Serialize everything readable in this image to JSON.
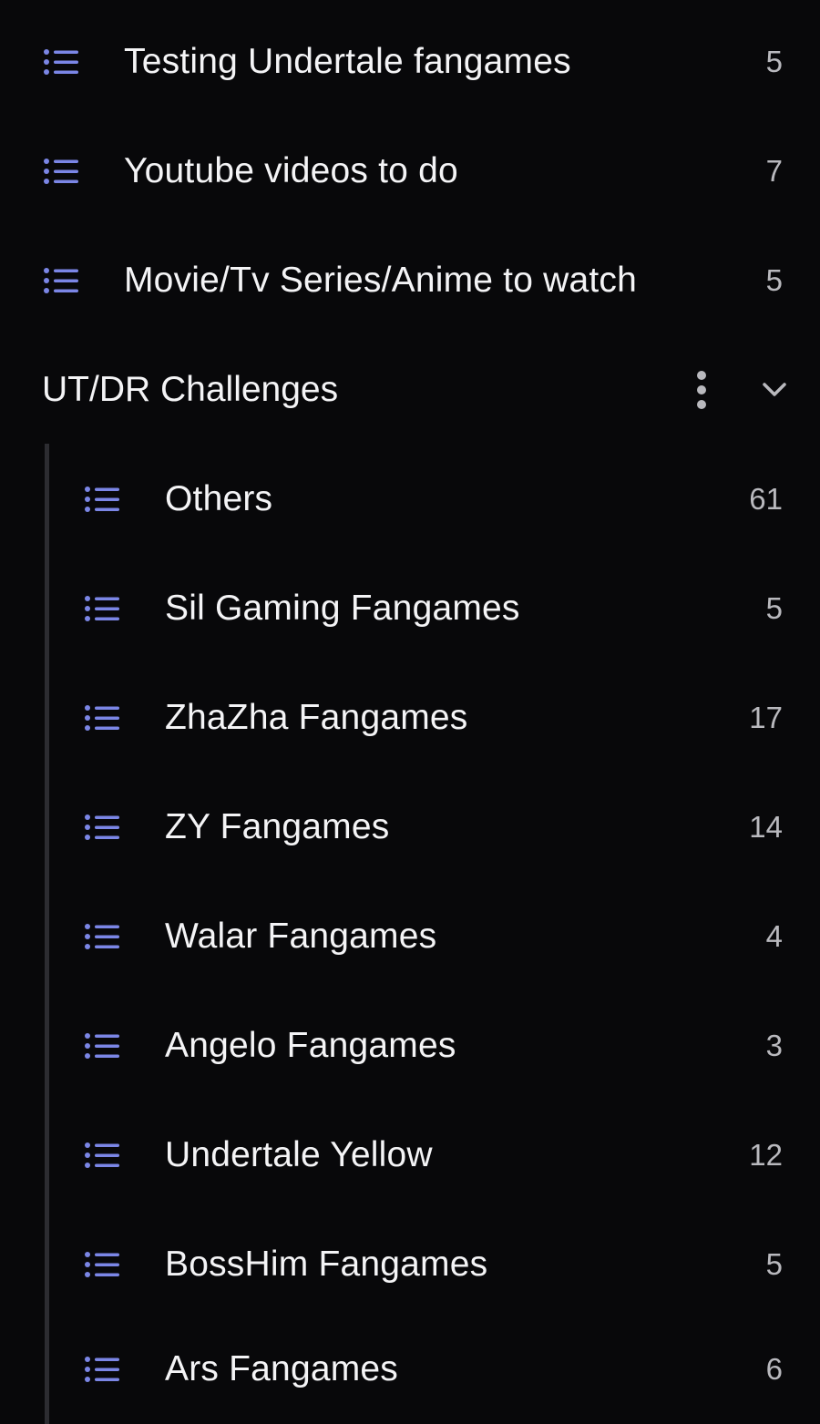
{
  "lists": [
    {
      "label": "Testing Undertale fangames",
      "count": "5",
      "icon": "list-icon"
    },
    {
      "label": "Youtube videos to do",
      "count": "7",
      "icon": "list-icon"
    },
    {
      "label": "Movie/Tv Series/Anime to watch",
      "count": "5",
      "icon": "list-icon"
    }
  ],
  "group": {
    "title": "UT/DR Challenges",
    "more_icon": "more-vertical-icon",
    "collapse_icon": "chevron-down-icon",
    "items": [
      {
        "label": "Others",
        "count": "61",
        "icon": "list-icon"
      },
      {
        "label": "Sil Gaming Fangames",
        "count": "5",
        "icon": "list-icon"
      },
      {
        "label": "ZhaZha Fangames",
        "count": "17",
        "icon": "list-icon"
      },
      {
        "label": "ZY Fangames",
        "count": "14",
        "icon": "list-icon"
      },
      {
        "label": "Walar Fangames",
        "count": "4",
        "icon": "list-icon"
      },
      {
        "label": "Angelo Fangames",
        "count": "3",
        "icon": "list-icon"
      },
      {
        "label": "Undertale Yellow",
        "count": "12",
        "icon": "list-icon"
      },
      {
        "label": "BossHim Fangames",
        "count": "5",
        "icon": "list-icon"
      },
      {
        "label": "Ars Fangames",
        "count": "6",
        "icon": "list-icon"
      }
    ]
  },
  "colors": {
    "background": "#08080a",
    "icon_accent": "#7b86e6",
    "text_primary": "#f4f4f6",
    "text_secondary": "#b9b9be",
    "tree_line": "#2c2c31"
  }
}
